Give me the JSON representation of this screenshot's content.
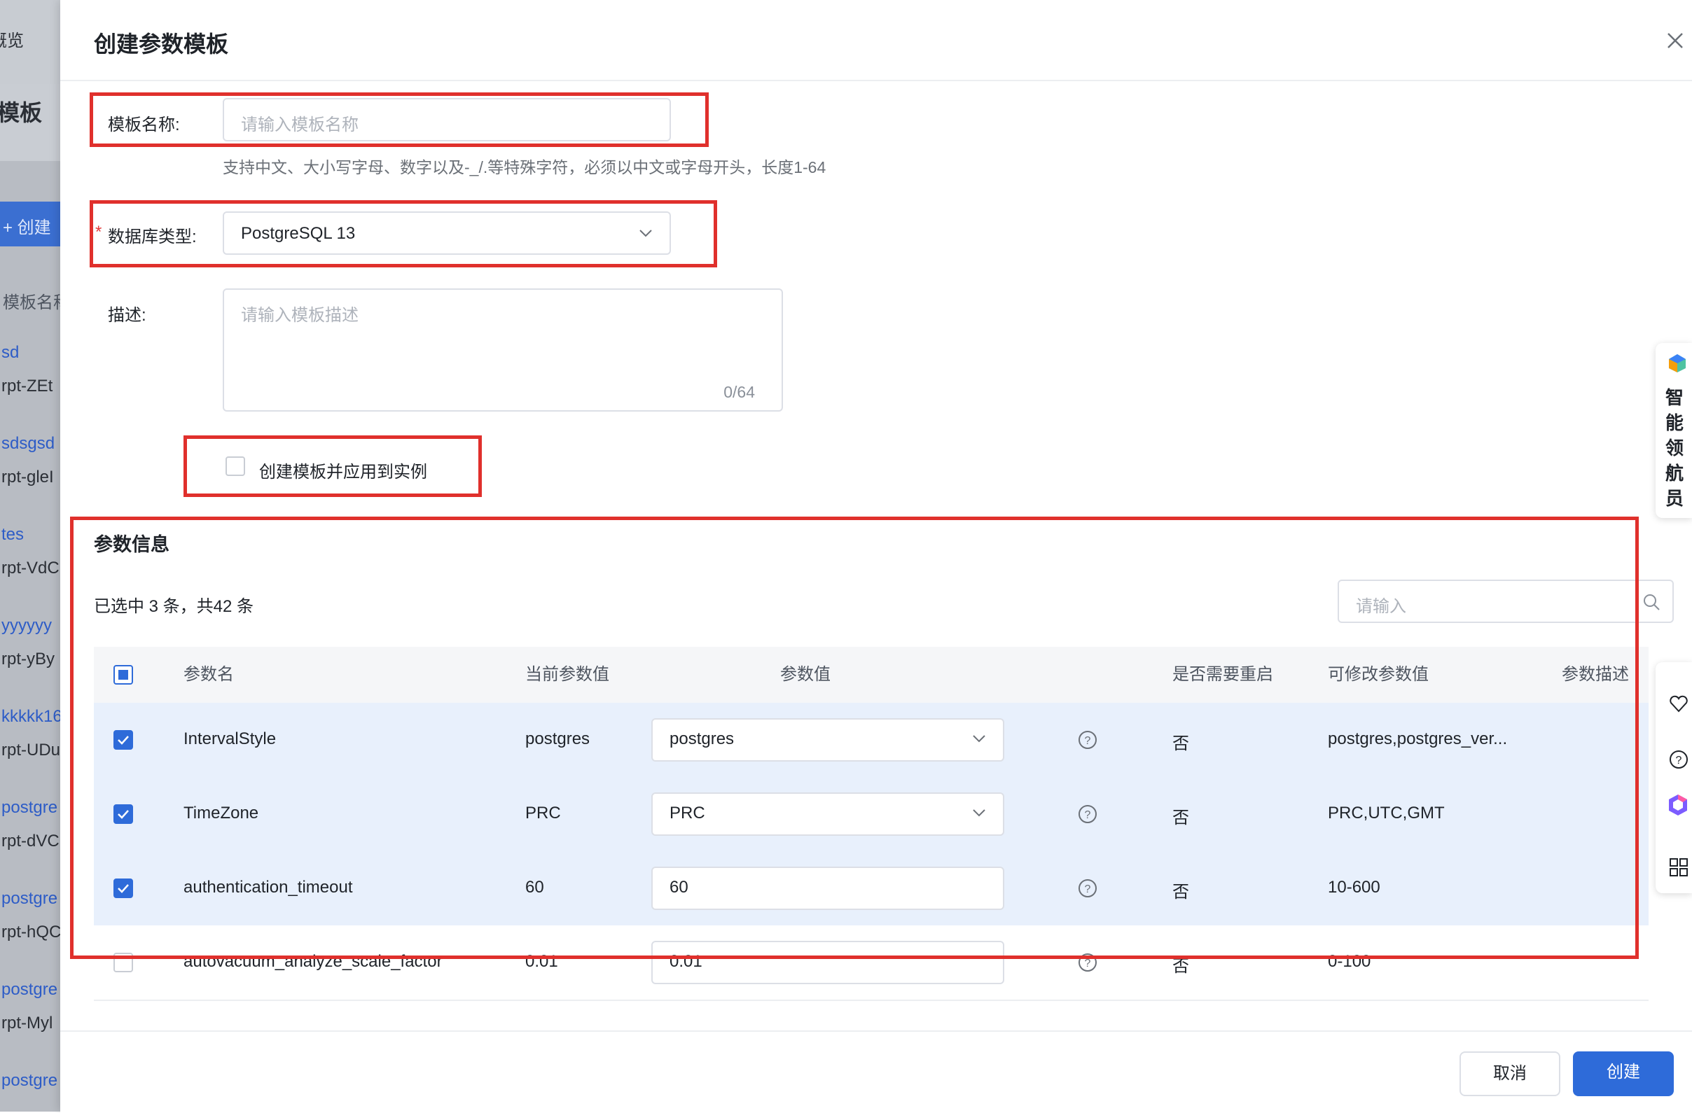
{
  "background_page": {
    "nav_fragment": "概览",
    "page_title_fragment": "模板",
    "create_button_fragment": "+ 创建",
    "column_fragment": "模板名称",
    "rows": [
      {
        "name": "sd",
        "id": "rpt-ZEt"
      },
      {
        "name": "sdsgsd",
        "id": "rpt-gleI"
      },
      {
        "name": "tes",
        "id": "rpt-VdC"
      },
      {
        "name": "yyyyyy",
        "id": "rpt-yBy"
      },
      {
        "name": "kkkkk16",
        "id": "rpt-UDu"
      },
      {
        "name": "postgre",
        "id": "rpt-dVC"
      },
      {
        "name": "postgre",
        "id": "rpt-hQC"
      },
      {
        "name": "postgre",
        "id": "rpt-Myl"
      },
      {
        "name": "postgre",
        "id": ""
      }
    ]
  },
  "drawer": {
    "title": "创建参数模板",
    "close_icon": "close-icon"
  },
  "form": {
    "template_name_label": "模板名称:",
    "template_name_placeholder": "请输入模板名称",
    "template_name_hint": "支持中文、大小写字母、数字以及-_/.等特殊字符，必须以中文或字母开头，长度1-64",
    "db_type_required_mark": "*",
    "db_type_label": "数据库类型:",
    "db_type_value": "PostgreSQL 13",
    "description_label": "描述:",
    "description_placeholder": "请输入模板描述",
    "description_counter": "0/64",
    "apply_checkbox_label": "创建模板并应用到实例"
  },
  "params": {
    "section_title": "参数信息",
    "selection_summary": "已选中 3 条，共42 条",
    "search_placeholder": "请输入",
    "columns": [
      "参数名",
      "当前参数值",
      "参数值",
      "是否需要重启",
      "可修改参数值",
      "参数描述"
    ],
    "rows": [
      {
        "name": "IntervalStyle",
        "current": "postgres",
        "value": "postgres",
        "control": "select",
        "restart": "否",
        "allowed": "postgres,postgres_ver...",
        "checked": true
      },
      {
        "name": "TimeZone",
        "current": "PRC",
        "value": "PRC",
        "control": "select",
        "restart": "否",
        "allowed": "PRC,UTC,GMT",
        "checked": true
      },
      {
        "name": "authentication_timeout",
        "current": "60",
        "value": "60",
        "control": "input",
        "restart": "否",
        "allowed": "10-600",
        "checked": true
      },
      {
        "name": "autovacuum_analyze_scale_factor",
        "current": "0.01",
        "value": "0.01",
        "control": "input",
        "restart": "否",
        "allowed": "0-100",
        "checked": false
      }
    ]
  },
  "footer": {
    "cancel_label": "取消",
    "create_label": "创建"
  },
  "assistant": {
    "label": "智能领航员"
  },
  "colors": {
    "primary": "#2e6bd9",
    "highlight_border": "#e0302c",
    "selected_row": "#e8f0fc"
  }
}
